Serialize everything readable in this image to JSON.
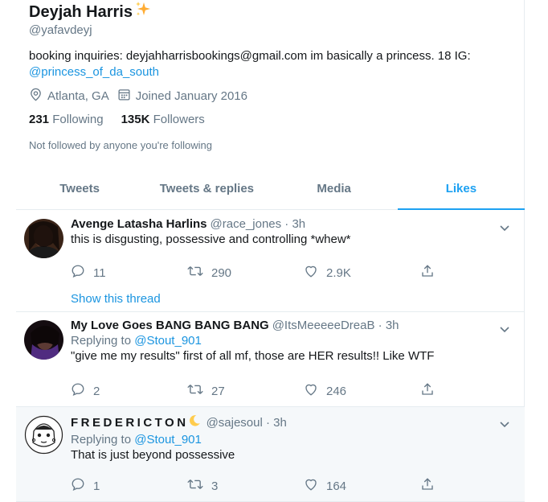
{
  "profile": {
    "name": "Deyjah Harris",
    "name_emoji": "sparkles",
    "handle": "@yafavdeyj",
    "bio_text": "booking inquiries: deyjahharrisbookings@gmail.com im basically a princess. 18 IG:",
    "bio_link": "@princess_of_da_south",
    "location": "Atlanta, GA",
    "joined": "Joined January 2016",
    "following_count": "231",
    "following_label": "Following",
    "followers_count": "135K",
    "followers_label": "Followers",
    "not_followed": "Not followed by anyone you're following"
  },
  "tabs": [
    {
      "label": "Tweets",
      "active": false
    },
    {
      "label": "Tweets & replies",
      "active": false
    },
    {
      "label": "Media",
      "active": false
    },
    {
      "label": "Likes",
      "active": true
    }
  ],
  "tweets": [
    {
      "name": "Avenge Latasha Harlins",
      "handle_time": "@race_jones · 3h",
      "replying_prefix": "",
      "replying_to": "",
      "text": "this is disgusting, possessive and controlling *whew*",
      "replies": "11",
      "retweets": "290",
      "likes": "2.9K",
      "show_thread": "Show this thread"
    },
    {
      "name": "My Love Goes BANG BANG BANG",
      "handle_time": "@ItsMeeeeeDreaB · 3h",
      "replying_prefix": "Replying to",
      "replying_to": "@Stout_901",
      "text": "\"give me my results\" first of all mf, those are HER results!! Like WTF",
      "replies": "2",
      "retweets": "27",
      "likes": "246"
    },
    {
      "name": "FREDERICTON",
      "name_emoji": "crescent-moon",
      "handle_time": "@sajesoul · 3h",
      "replying_prefix": "Replying to",
      "replying_to": "@Stout_901",
      "text": "That is just beyond possessive",
      "replies": "1",
      "retweets": "3",
      "likes": "164"
    }
  ],
  "colors": {
    "accent": "#1da1f2",
    "link": "#1b95e0",
    "secondary_text": "#657786",
    "divider": "#e6ecf0"
  }
}
